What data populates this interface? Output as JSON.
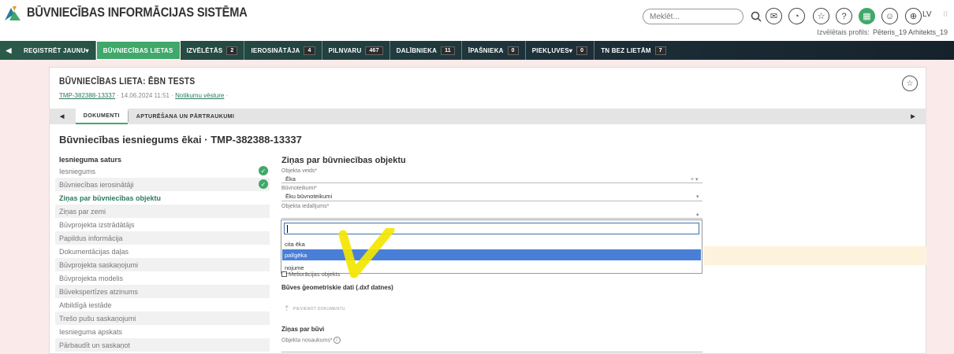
{
  "header": {
    "app_title": "BŪVNIECĪBAS INFORMĀCIJAS SISTĒMA",
    "search_placeholder": "Meklēt...",
    "lang": "LV",
    "profile_label": "Izvēlētais profils:",
    "profile_name": "Pēteris_19 Arhitekts_19",
    "icons": [
      "search-icon",
      "mail-icon",
      "notification-icon",
      "star-icon",
      "help-icon",
      "apps-icon",
      "user-icon",
      "globe-icon",
      "more-icon"
    ]
  },
  "nav": {
    "items": [
      {
        "label": "REĢISTRĒT JAUNU▾",
        "badge": ""
      },
      {
        "label": "BŪVNIECĪBAS LIETAS",
        "badge": ""
      },
      {
        "label": "IZVĒLĒTĀS",
        "badge": "2"
      },
      {
        "label": "IEROSINĀTĀJA",
        "badge": "4"
      },
      {
        "label": "PILNVARU",
        "badge": "467"
      },
      {
        "label": "DALĪBNIEKA",
        "badge": "11"
      },
      {
        "label": "ĪPAŠNIEKA",
        "badge": "0"
      },
      {
        "label": "PIEKĻUVES▾",
        "badge": "0"
      },
      {
        "label": "TN BEZ LIETĀM",
        "badge": "7"
      }
    ]
  },
  "case": {
    "title": "BŪVNIECĪBAS LIETA: ĒBN TESTS",
    "id": "TMP-382388-13337",
    "sep1": "·",
    "date": "14.06.2024 11:51",
    "sep2": "·",
    "history_link": "Notikumu vēsture",
    "sep3": "·"
  },
  "tabs": [
    "DOKUMENTI",
    "APTURĒŠANA UN PĀRTRAUKUMI"
  ],
  "page_title": "Būvniecības iesniegums ēkai · TMP-382388-13337",
  "sidebar": {
    "heading": "Iesnieguma saturs",
    "items": [
      {
        "label": "Iesniegums",
        "done": true
      },
      {
        "label": "Būvniecības ierosinātāji",
        "done": true
      },
      {
        "label": "Ziņas par būvniecības objektu",
        "current": true
      },
      {
        "label": "Ziņas par zemi"
      },
      {
        "label": "Būvprojekta izstrādātājs"
      },
      {
        "label": "Papildus informācija"
      },
      {
        "label": "Dokumentācijas daļas"
      },
      {
        "label": "Būvprojekta saskaņojumi"
      },
      {
        "label": "Būvprojekta modelis"
      },
      {
        "label": "Būvekspertīzes atzinums"
      },
      {
        "label": "Atbildīgā iestāde"
      },
      {
        "label": "Trešo pušu saskaņojumi"
      },
      {
        "label": "Iesnieguma apskats"
      },
      {
        "label": "Pārbaudīt un saskaņot"
      }
    ]
  },
  "form": {
    "title": "Ziņas par būvniecības objektu",
    "object_type_label": "Objekta veids*",
    "object_type_value": "Ēka",
    "object_type_ctrl": "× ▾",
    "construction_label": "Būvnoteikumi*",
    "construction_value": "Ēku būvnoteikumi",
    "construction_ctrl": "▾",
    "division_label": "Objekta iedalījums*",
    "division_ctrl": "▴",
    "dropdown_options": [
      "cita ēka",
      "palīgēka",
      "nojume"
    ],
    "dropdown_highlighted": 1,
    "melioration_label": "Meliorācijas objekts",
    "geo_title": "Būves ģeometriskie dati (.dxf datnes)",
    "upload_label": "PIEVIENOT DOKUMENTU",
    "building_title": "Ziņas par būvi",
    "name_label": "Objekta nosaukums*"
  },
  "colors": {
    "accent_green": "#3fa86a",
    "nav_dark": "#1c2f38",
    "highlight_blue": "#4a7fd8",
    "annotation_yellow": "#f2e600"
  }
}
